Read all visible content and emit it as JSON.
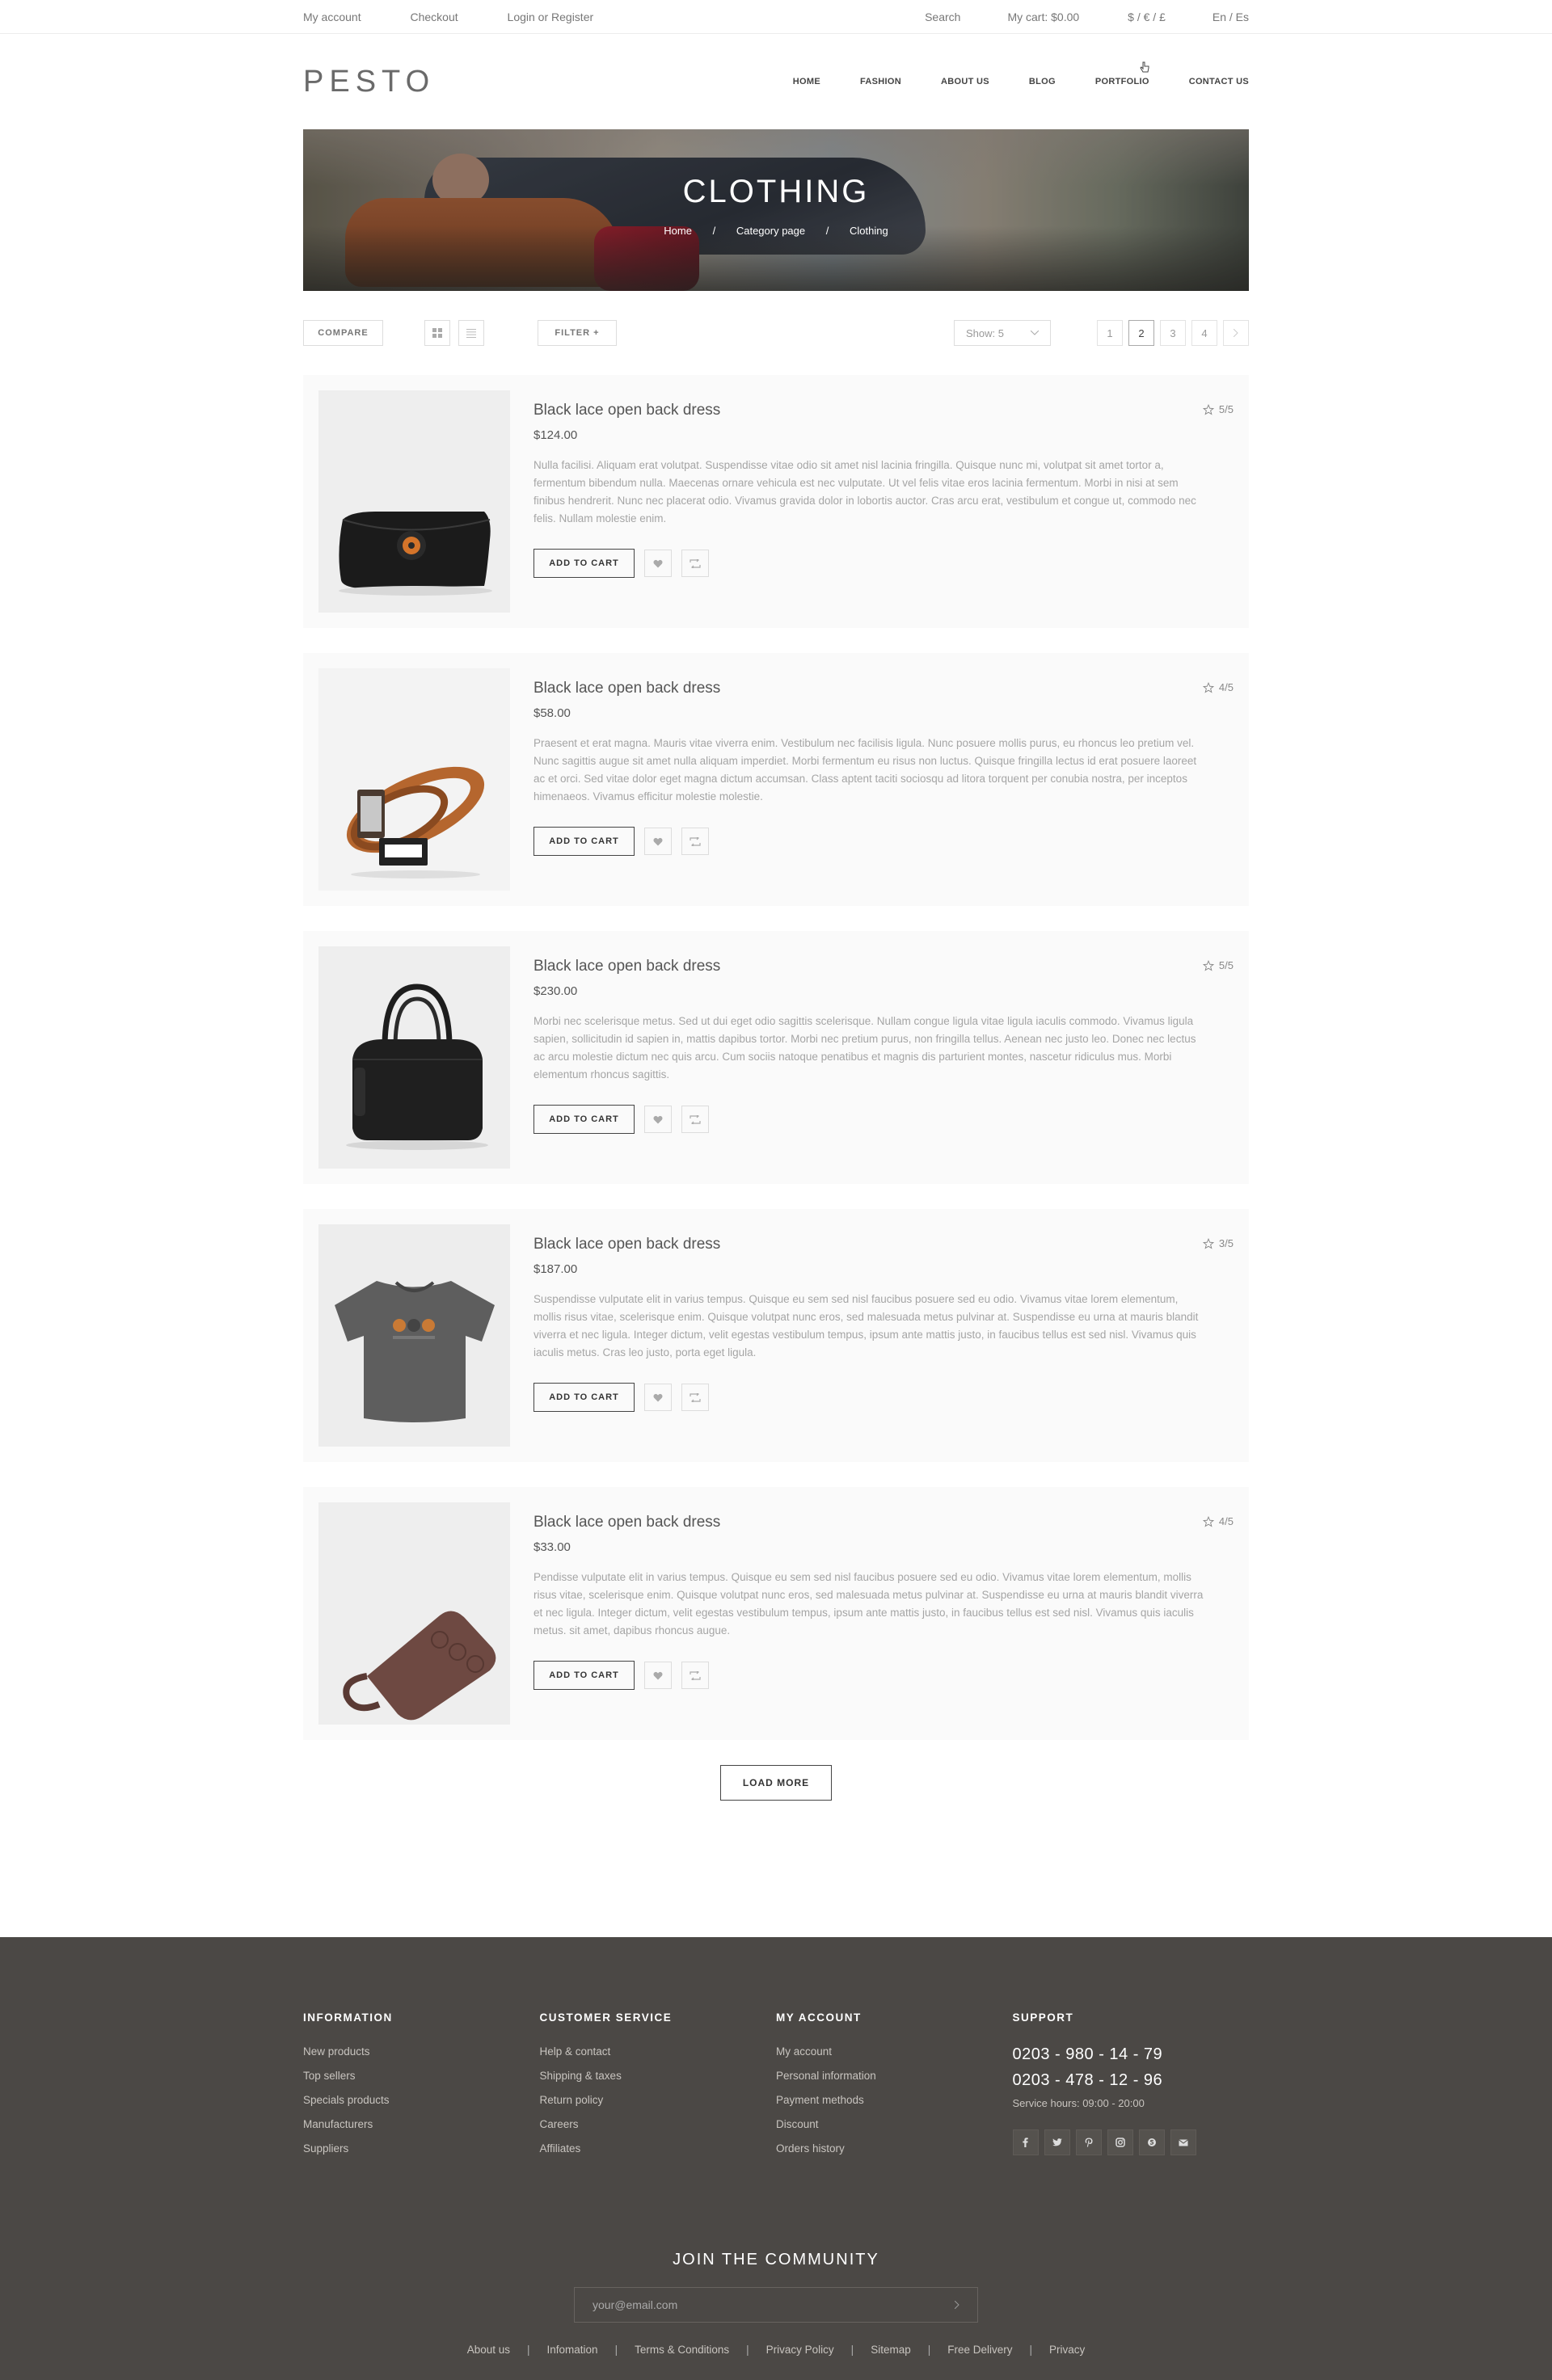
{
  "topbar": {
    "links": [
      "My account",
      "Checkout",
      "Login or Register"
    ],
    "search": "Search",
    "cart": "My cart: $0.00",
    "currency": "$ / € / £",
    "language": "En / Es"
  },
  "header": {
    "logo": "PESTO",
    "nav": [
      "HOME",
      "FASHION",
      "ABOUT US",
      "BLOG",
      "PORTFOLIO",
      "CONTACT US"
    ]
  },
  "banner": {
    "title": "CLOTHING",
    "breadcrumb": [
      "Home",
      "Category page",
      "Clothing"
    ],
    "separator": "/"
  },
  "toolbar": {
    "compare": "COMPARE",
    "filter": "FILTER +",
    "show": "Show: 5",
    "pages": [
      "1",
      "2",
      "3",
      "4"
    ],
    "active_page": "2"
  },
  "products": [
    {
      "title": "Black lace open back dress",
      "price": "$124.00",
      "rating": "5/5",
      "description": "Nulla facilisi. Aliquam erat volutpat. Suspendisse vitae odio sit amet nisl lacinia fringilla. Quisque nunc mi, volutpat sit amet tortor a, fermentum bibendum nulla. Maecenas ornare vehicula est nec vulputate. Ut vel felis vitae eros lacinia fermentum. Morbi in nisi at sem finibus hendrerit. Nunc nec placerat odio. Vivamus gravida dolor in lobortis auctor. Cras arcu erat, vestibulum et congue ut, commodo nec felis. Nullam molestie enim.",
      "image": "black-clutch"
    },
    {
      "title": "Black lace open back dress",
      "price": "$58.00",
      "rating": "4/5",
      "description": "Praesent et erat magna. Mauris vitae viverra enim. Vestibulum nec facilisis ligula. Nunc posuere mollis purus, eu rhoncus leo pretium vel. Nunc sagittis augue sit amet nulla aliquam imperdiet. Morbi fermentum eu risus non luctus. Quisque fringilla lectus id erat posuere laoreet ac et orci. Sed vitae dolor eget magna dictum accumsan. Class aptent taciti sociosqu ad litora torquent per conubia nostra, per inceptos himenaeos. Vivamus efficitur molestie molestie.",
      "image": "leather-belt"
    },
    {
      "title": "Black lace open back dress",
      "price": "$230.00",
      "rating": "5/5",
      "description": "Morbi nec scelerisque metus. Sed ut dui eget odio sagittis scelerisque. Nullam congue ligula vitae ligula iaculis commodo. Vivamus ligula sapien, sollicitudin id sapien in, mattis dapibus tortor. Morbi nec pretium purus, non fringilla tellus. Aenean nec justo leo. Donec nec lectus ac arcu molestie dictum nec quis arcu. Cum sociis natoque penatibus et magnis dis parturient montes, nascetur ridiculus mus. Morbi elementum rhoncus sagittis.",
      "image": "black-handbag"
    },
    {
      "title": "Black lace open back dress",
      "price": "$187.00",
      "rating": "3/5",
      "description": "Suspendisse vulputate elit in varius tempus. Quisque eu sem sed nisl faucibus posuere sed eu odio. Vivamus vitae lorem elementum, mollis risus vitae, scelerisque enim. Quisque volutpat nunc eros, sed malesuada metus pulvinar at. Suspendisse eu urna at mauris blandit viverra et nec ligula. Integer dictum, velit egestas vestibulum tempus, ipsum ante mattis justo, in faucibus tellus est sed nisl. Vivamus quis iaculis metus. Cras leo justo, porta eget ligula.",
      "image": "grey-tshirt"
    },
    {
      "title": "Black lace open back dress",
      "price": "$33.00",
      "rating": "4/5",
      "description": "Pendisse vulputate elit in varius tempus. Quisque eu sem sed nisl faucibus posuere sed eu odio. Vivamus vitae lorem elementum, mollis risus vitae, scelerisque enim. Quisque volutpat nunc eros, sed malesuada metus pulvinar at. Suspendisse eu urna at mauris blandit viverra et nec ligula. Integer dictum, velit egestas vestibulum tempus, ipsum ante mattis justo, in faucibus tellus est sed nisl. Vivamus quis iaculis metus.  sit amet, dapibus rhoncus augue.",
      "image": "leather-tag"
    }
  ],
  "labels": {
    "add_to_cart": "ADD TO CART",
    "load_more": "LOAD MORE"
  },
  "footer": {
    "columns": [
      {
        "heading": "INFORMATION",
        "links": [
          "New products",
          "Top sellers",
          "Specials products",
          "Manufacturers",
          "Suppliers"
        ]
      },
      {
        "heading": "CUSTOMER SERVICE",
        "links": [
          "Help & contact",
          "Shipping & taxes",
          "Return policy",
          "Careers",
          "Affiliates"
        ]
      },
      {
        "heading": "MY ACCOUNT",
        "links": [
          "My account",
          "Personal information",
          "Payment methods",
          "Discount",
          "Orders history"
        ]
      }
    ],
    "support": {
      "heading": "SUPPORT",
      "phones": [
        "0203 - 980 - 14 - 79",
        "0203 - 478 - 12 - 96"
      ],
      "hours": "Service hours: 09:00 - 20:00",
      "social": [
        "f",
        "t",
        "p",
        "i",
        "s",
        "m"
      ]
    },
    "join": "JOIN THE COMMUNITY",
    "email_placeholder": "your@email.com",
    "bottom_links": [
      "About us",
      "Infomation",
      "Terms & Conditions",
      "Privacy Policy",
      "Sitemap",
      "Free Delivery",
      "Privacy"
    ]
  }
}
